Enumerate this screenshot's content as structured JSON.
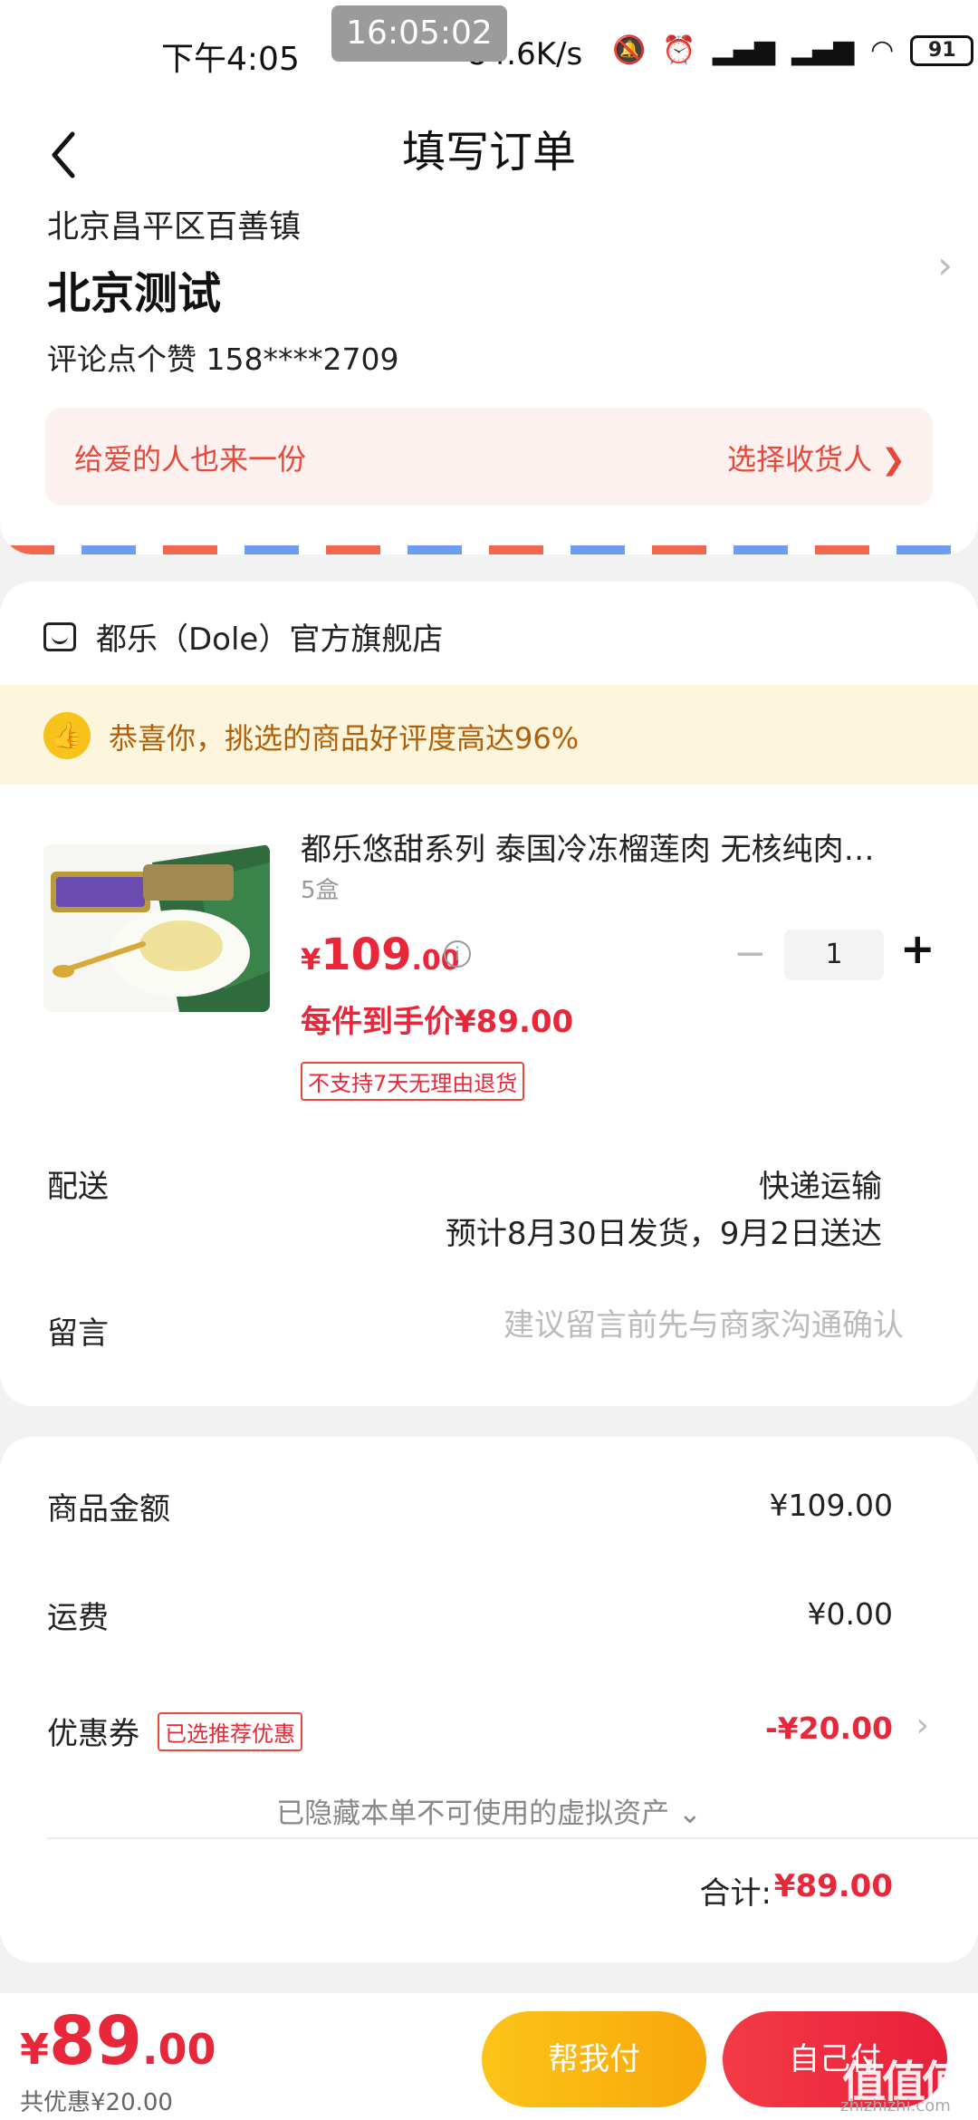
{
  "status_bar": {
    "time": "下午4:05",
    "overlay_time": "16:05:02",
    "net_speed": "84.6K/s",
    "icons": [
      "mute-icon",
      "alarm-icon",
      "signal-hd-icon",
      "signal-hd-icon",
      "wifi-icon"
    ],
    "battery": "91"
  },
  "header": {
    "title": "填写订单"
  },
  "address": {
    "region": "北京昌平区百善镇",
    "name": "北京测试",
    "contact": "评论点个赞  158****2709",
    "gift_text": "给爱的人也来一份",
    "gift_action": "选择收货人 ❯"
  },
  "store": {
    "name": "都乐（Dole）官方旗舰店",
    "promo": "恭喜你，挑选的商品好评度高达96%",
    "product": {
      "title": "都乐悠甜系列 泰国冷冻榴莲肉 无核纯肉…",
      "spec": "5盒",
      "price_yen": "¥",
      "price_int": "109",
      "price_dec": ".00",
      "quantity": "1",
      "final_price": "每件到手价¥89.00",
      "return_tag": "不支持7天无理由退货"
    },
    "shipping": {
      "label": "配送",
      "method": "快递运输",
      "eta": "预计8月30日发货，9月2日送达"
    },
    "message": {
      "label": "留言",
      "placeholder": "建议留言前先与商家沟通确认"
    }
  },
  "summary": {
    "goods_label": "商品金额",
    "goods_value": "¥109.00",
    "freight_label": "运费",
    "freight_value": "¥0.00",
    "coupon_label": "优惠券",
    "coupon_tag": "已选推荐优惠",
    "coupon_value": "-¥20.00",
    "hidden_assets": "已隐藏本单不可使用的虚拟资产 ⌄",
    "total_label": "合计:",
    "total_value": "¥89.00"
  },
  "bottom_bar": {
    "price_yen": "¥",
    "price_int": "89",
    "price_dec": ".00",
    "saved": "共优惠¥20.00",
    "help_pay": "帮我付",
    "self_pay": "自己付"
  },
  "watermark": {
    "logo": "值值值",
    "site": "zhizhizhi.com"
  },
  "colors": {
    "accent_red": "#e8283a",
    "promo_brown": "#b25f08",
    "help_yellow": "#fcc419"
  }
}
